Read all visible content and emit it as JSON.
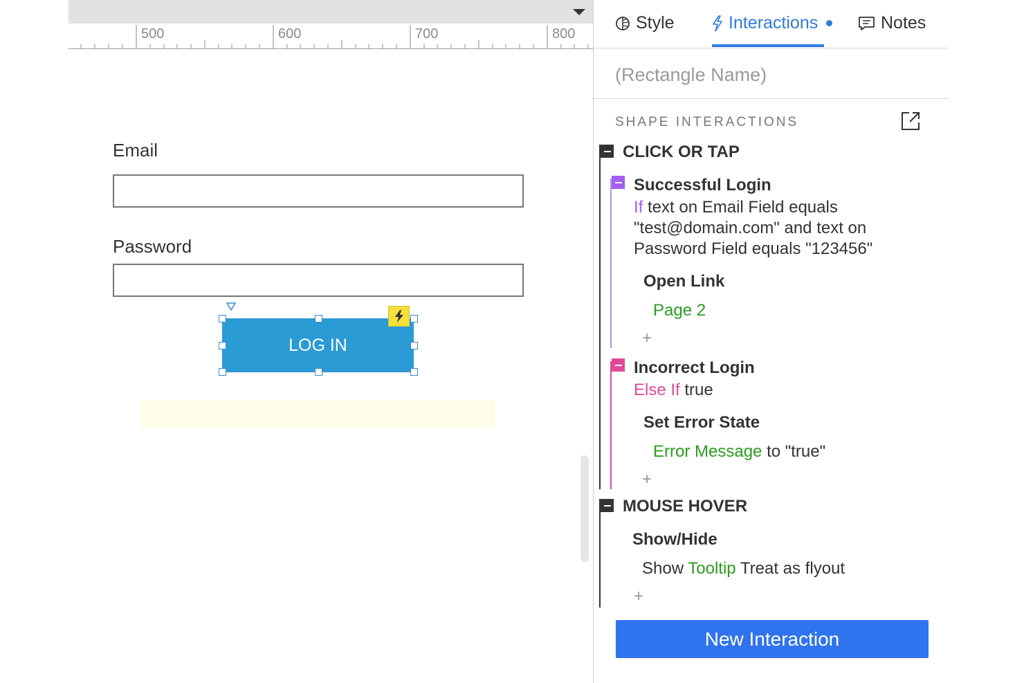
{
  "canvas": {
    "ruler_labels": [
      "500",
      "600",
      "700",
      "800"
    ],
    "email_label": "Email",
    "password_label": "Password",
    "login_button_label": "LOG IN"
  },
  "panel": {
    "tabs": [
      {
        "label": "Style",
        "icon": "style-icon"
      },
      {
        "label": "Interactions",
        "icon": "lightning-icon",
        "active": true,
        "has_changes": true
      },
      {
        "label": "Notes",
        "icon": "notes-icon"
      }
    ],
    "shape_name_placeholder": "(Rectangle Name)",
    "section_title": "SHAPE INTERACTIONS",
    "events": [
      {
        "title": "CLICK OR TAP",
        "cases": [
          {
            "name": "Successful Login",
            "keyword": "If",
            "condition_lines": [
              "text on Email Field equals",
              "\"test@domain.com\" and text on",
              "Password Field equals \"123456\""
            ],
            "action": "Open Link",
            "target": "Page 2",
            "color": "#a25ef0"
          },
          {
            "name": "Incorrect Login",
            "keyword": "Else If",
            "condition": "true",
            "action": "Set Error State",
            "target": "Error Message",
            "target_suffix": "to \"true\"",
            "color": "#e2499a"
          }
        ]
      },
      {
        "title": "MOUSE HOVER",
        "action": "Show/Hide",
        "verb": "Show",
        "target": "Tooltip",
        "option": "Treat as flyout"
      }
    ],
    "add_symbol": "+",
    "new_interaction_label": "New Interaction"
  }
}
